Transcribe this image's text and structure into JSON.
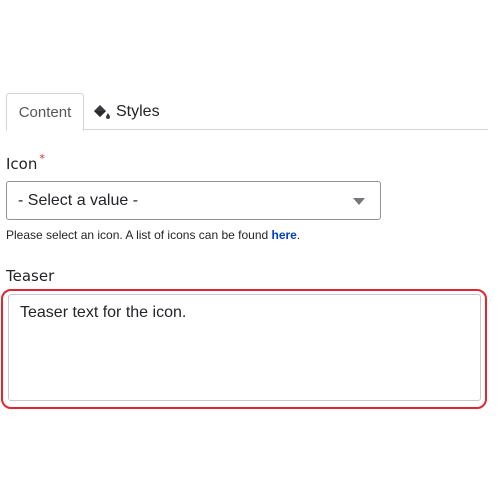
{
  "tabs": [
    {
      "label": "Content",
      "active": true
    },
    {
      "label": "Styles",
      "icon": "paint-bucket-icon",
      "active": false
    }
  ],
  "icon_field": {
    "label": "Icon",
    "required_marker": "*",
    "selected_value": "- Select a value -",
    "help_text": "Please select an icon. A list of icons can be found ",
    "help_link": "here",
    "help_suffix": "."
  },
  "teaser_field": {
    "label": "Teaser",
    "value": "Teaser text for the icon."
  },
  "colors": {
    "required": "#dc2323",
    "link": "#003ecc",
    "highlight_border": "#e3262e"
  }
}
